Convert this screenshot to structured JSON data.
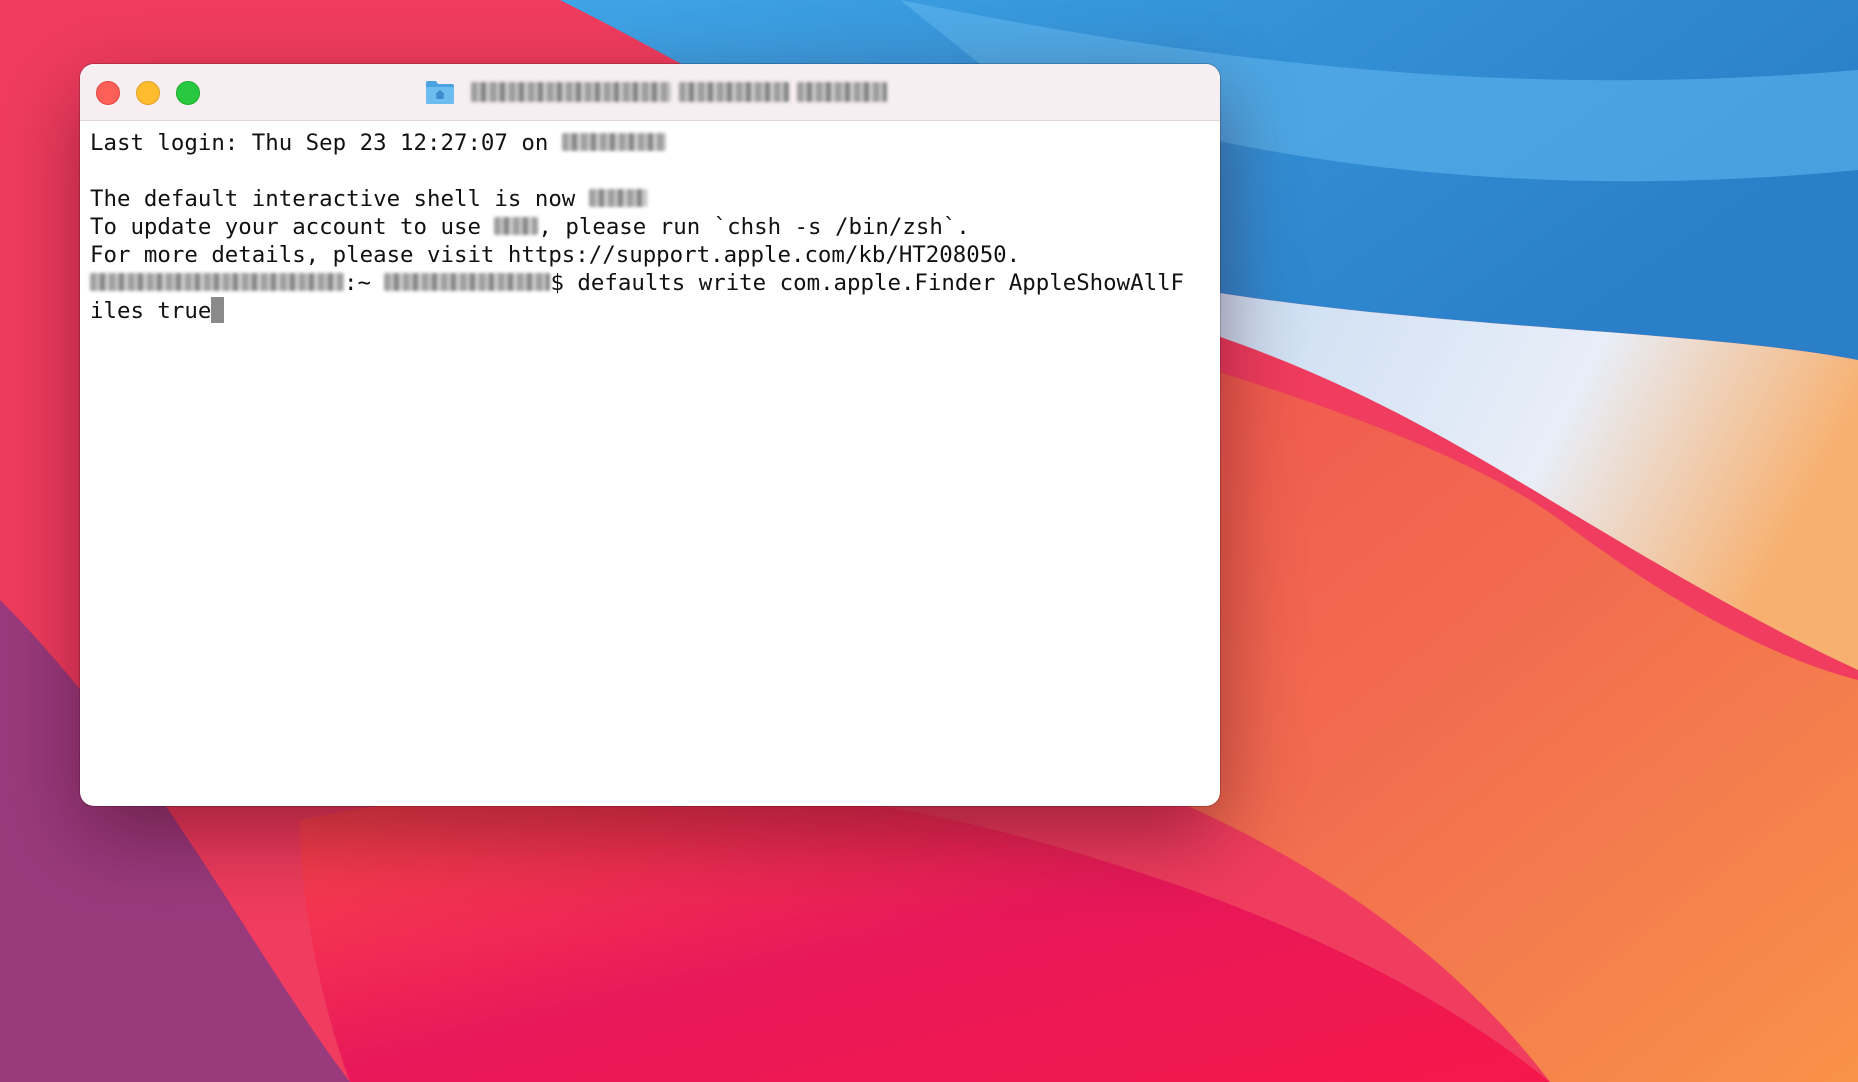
{
  "window": {
    "title": "",
    "title_icon": "home-folder-icon"
  },
  "terminal": {
    "last_login_prefix": "Last login: Thu Sep 23 12:27:07 on",
    "shell_notice": "The default interactive shell is now",
    "update_prefix": "To update your account to use",
    "update_suffix": ", please run `chsh -s /bin/zsh`.",
    "details_line": "For more details, please visit https://support.apple.com/kb/HT208050.",
    "prompt_separator": ":~",
    "prompt_symbol": "$",
    "command_line1": " defaults write com.apple.Finder AppleShowAllF",
    "command_line2": "iles true"
  },
  "colors": {
    "close": "#fe5f57",
    "minimize": "#febc2e",
    "zoom": "#28c840"
  }
}
